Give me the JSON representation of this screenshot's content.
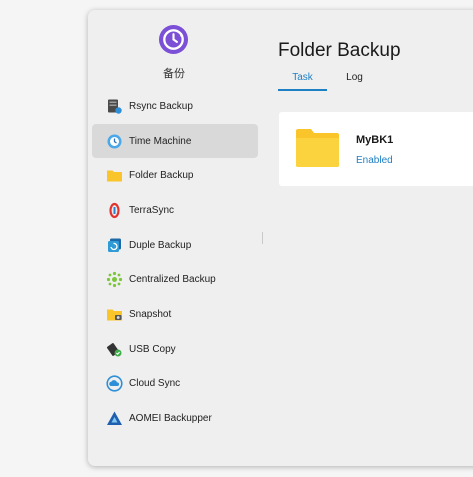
{
  "app": {
    "name": "备份",
    "logo_icon": "clock-history-icon",
    "accent": "#7b4fd6"
  },
  "sidebar": {
    "items": [
      {
        "label": "Rsync Backup",
        "icon": "rsync-server-icon",
        "active": false
      },
      {
        "label": "Time Machine",
        "icon": "time-machine-icon",
        "active": true
      },
      {
        "label": "Folder Backup",
        "icon": "folder-icon",
        "active": false
      },
      {
        "label": "TerraSync",
        "icon": "terrasync-icon",
        "active": false
      },
      {
        "label": "Duple Backup",
        "icon": "duple-backup-icon",
        "active": false
      },
      {
        "label": "Centralized Backup",
        "icon": "centralized-backup-icon",
        "active": false
      },
      {
        "label": "Snapshot",
        "icon": "snapshot-folder-icon",
        "active": false
      },
      {
        "label": "USB Copy",
        "icon": "usb-copy-icon",
        "active": false
      },
      {
        "label": "Cloud Sync",
        "icon": "cloud-sync-icon",
        "active": false
      },
      {
        "label": "AOMEI Backupper",
        "icon": "aomei-logo-icon",
        "active": false
      }
    ]
  },
  "main": {
    "title": "Folder Backup",
    "tabs": [
      {
        "label": "Task",
        "active": true
      },
      {
        "label": "Log",
        "active": false
      }
    ],
    "tasks": [
      {
        "name": "MyBK1",
        "status": "Enabled",
        "icon": "folder-icon"
      }
    ]
  },
  "colors": {
    "link_blue": "#1d7fc4",
    "folder_yellow": "#f9c52a",
    "active_item_bg": "#d9d9d9"
  }
}
